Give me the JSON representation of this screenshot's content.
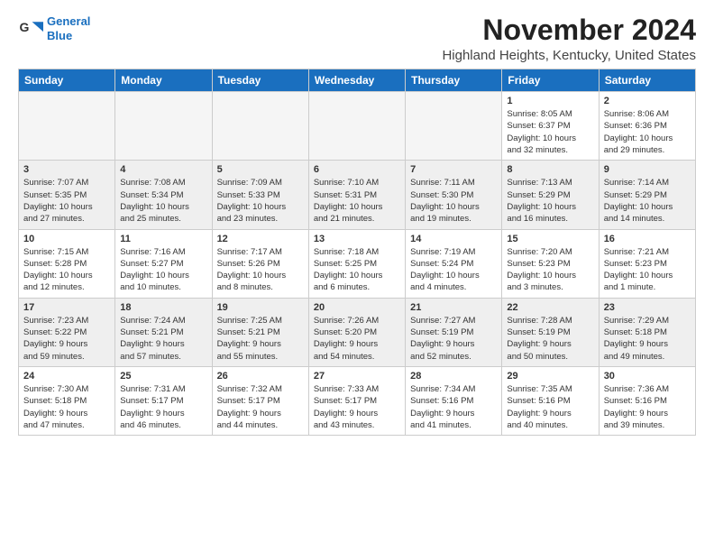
{
  "header": {
    "logo_line1": "General",
    "logo_line2": "Blue",
    "month": "November 2024",
    "location": "Highland Heights, Kentucky, United States"
  },
  "weekdays": [
    "Sunday",
    "Monday",
    "Tuesday",
    "Wednesday",
    "Thursday",
    "Friday",
    "Saturday"
  ],
  "weeks": [
    {
      "shaded": false,
      "days": [
        {
          "num": "",
          "info": ""
        },
        {
          "num": "",
          "info": ""
        },
        {
          "num": "",
          "info": ""
        },
        {
          "num": "",
          "info": ""
        },
        {
          "num": "",
          "info": ""
        },
        {
          "num": "1",
          "info": "Sunrise: 8:05 AM\nSunset: 6:37 PM\nDaylight: 10 hours\nand 32 minutes."
        },
        {
          "num": "2",
          "info": "Sunrise: 8:06 AM\nSunset: 6:36 PM\nDaylight: 10 hours\nand 29 minutes."
        }
      ]
    },
    {
      "shaded": true,
      "days": [
        {
          "num": "3",
          "info": "Sunrise: 7:07 AM\nSunset: 5:35 PM\nDaylight: 10 hours\nand 27 minutes."
        },
        {
          "num": "4",
          "info": "Sunrise: 7:08 AM\nSunset: 5:34 PM\nDaylight: 10 hours\nand 25 minutes."
        },
        {
          "num": "5",
          "info": "Sunrise: 7:09 AM\nSunset: 5:33 PM\nDaylight: 10 hours\nand 23 minutes."
        },
        {
          "num": "6",
          "info": "Sunrise: 7:10 AM\nSunset: 5:31 PM\nDaylight: 10 hours\nand 21 minutes."
        },
        {
          "num": "7",
          "info": "Sunrise: 7:11 AM\nSunset: 5:30 PM\nDaylight: 10 hours\nand 19 minutes."
        },
        {
          "num": "8",
          "info": "Sunrise: 7:13 AM\nSunset: 5:29 PM\nDaylight: 10 hours\nand 16 minutes."
        },
        {
          "num": "9",
          "info": "Sunrise: 7:14 AM\nSunset: 5:29 PM\nDaylight: 10 hours\nand 14 minutes."
        }
      ]
    },
    {
      "shaded": false,
      "days": [
        {
          "num": "10",
          "info": "Sunrise: 7:15 AM\nSunset: 5:28 PM\nDaylight: 10 hours\nand 12 minutes."
        },
        {
          "num": "11",
          "info": "Sunrise: 7:16 AM\nSunset: 5:27 PM\nDaylight: 10 hours\nand 10 minutes."
        },
        {
          "num": "12",
          "info": "Sunrise: 7:17 AM\nSunset: 5:26 PM\nDaylight: 10 hours\nand 8 minutes."
        },
        {
          "num": "13",
          "info": "Sunrise: 7:18 AM\nSunset: 5:25 PM\nDaylight: 10 hours\nand 6 minutes."
        },
        {
          "num": "14",
          "info": "Sunrise: 7:19 AM\nSunset: 5:24 PM\nDaylight: 10 hours\nand 4 minutes."
        },
        {
          "num": "15",
          "info": "Sunrise: 7:20 AM\nSunset: 5:23 PM\nDaylight: 10 hours\nand 3 minutes."
        },
        {
          "num": "16",
          "info": "Sunrise: 7:21 AM\nSunset: 5:23 PM\nDaylight: 10 hours\nand 1 minute."
        }
      ]
    },
    {
      "shaded": true,
      "days": [
        {
          "num": "17",
          "info": "Sunrise: 7:23 AM\nSunset: 5:22 PM\nDaylight: 9 hours\nand 59 minutes."
        },
        {
          "num": "18",
          "info": "Sunrise: 7:24 AM\nSunset: 5:21 PM\nDaylight: 9 hours\nand 57 minutes."
        },
        {
          "num": "19",
          "info": "Sunrise: 7:25 AM\nSunset: 5:21 PM\nDaylight: 9 hours\nand 55 minutes."
        },
        {
          "num": "20",
          "info": "Sunrise: 7:26 AM\nSunset: 5:20 PM\nDaylight: 9 hours\nand 54 minutes."
        },
        {
          "num": "21",
          "info": "Sunrise: 7:27 AM\nSunset: 5:19 PM\nDaylight: 9 hours\nand 52 minutes."
        },
        {
          "num": "22",
          "info": "Sunrise: 7:28 AM\nSunset: 5:19 PM\nDaylight: 9 hours\nand 50 minutes."
        },
        {
          "num": "23",
          "info": "Sunrise: 7:29 AM\nSunset: 5:18 PM\nDaylight: 9 hours\nand 49 minutes."
        }
      ]
    },
    {
      "shaded": false,
      "days": [
        {
          "num": "24",
          "info": "Sunrise: 7:30 AM\nSunset: 5:18 PM\nDaylight: 9 hours\nand 47 minutes."
        },
        {
          "num": "25",
          "info": "Sunrise: 7:31 AM\nSunset: 5:17 PM\nDaylight: 9 hours\nand 46 minutes."
        },
        {
          "num": "26",
          "info": "Sunrise: 7:32 AM\nSunset: 5:17 PM\nDaylight: 9 hours\nand 44 minutes."
        },
        {
          "num": "27",
          "info": "Sunrise: 7:33 AM\nSunset: 5:17 PM\nDaylight: 9 hours\nand 43 minutes."
        },
        {
          "num": "28",
          "info": "Sunrise: 7:34 AM\nSunset: 5:16 PM\nDaylight: 9 hours\nand 41 minutes."
        },
        {
          "num": "29",
          "info": "Sunrise: 7:35 AM\nSunset: 5:16 PM\nDaylight: 9 hours\nand 40 minutes."
        },
        {
          "num": "30",
          "info": "Sunrise: 7:36 AM\nSunset: 5:16 PM\nDaylight: 9 hours\nand 39 minutes."
        }
      ]
    }
  ]
}
